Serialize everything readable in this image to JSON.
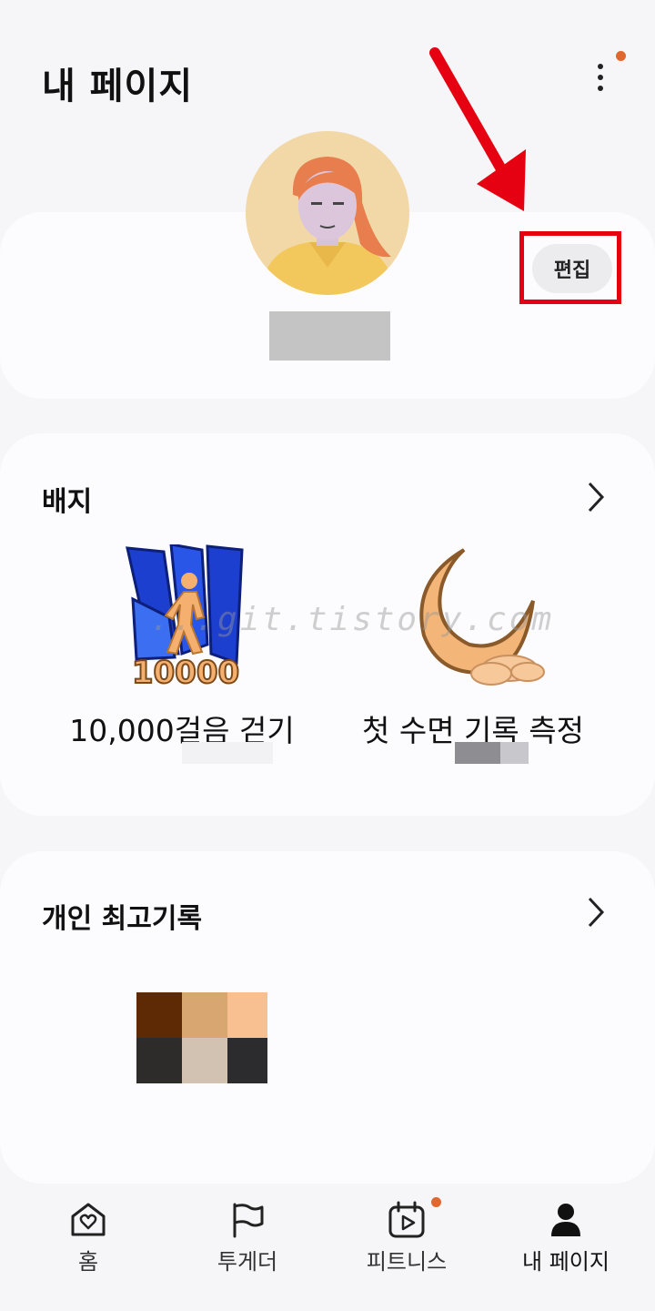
{
  "header": {
    "title": "내 페이지",
    "more_icon": "more-vertical-icon",
    "notification_dot_color": "#e0672d"
  },
  "profile": {
    "edit_label": "편집",
    "annotation_color": "#e50012"
  },
  "badges": {
    "title": "배지",
    "items": [
      {
        "label": "10,000걸음 걷기",
        "icon": "walking-10000-badge-icon"
      },
      {
        "label": "첫 수면 기록 측정",
        "icon": "crescent-moon-badge-icon"
      }
    ]
  },
  "records": {
    "title": "개인 최고기록"
  },
  "watermark": "...git.tistory.com",
  "bottom_nav": {
    "items": [
      {
        "label": "홈",
        "icon": "home-heart-icon"
      },
      {
        "label": "투게더",
        "icon": "flag-icon"
      },
      {
        "label": "피트니스",
        "icon": "calendar-play-icon"
      },
      {
        "label": "내 페이지",
        "icon": "person-icon"
      }
    ]
  },
  "colors": {
    "accent": "#e0672d",
    "background": "#f6f6f8",
    "card": "#fcfcfe"
  }
}
